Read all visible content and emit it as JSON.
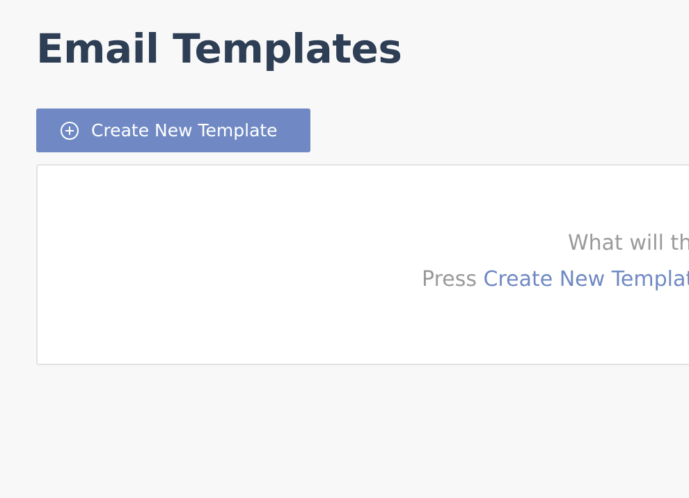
{
  "page": {
    "title": "Email Templates"
  },
  "toolbar": {
    "create_label": "Create New Template",
    "create_icon": "plus-circle-icon"
  },
  "empty_state": {
    "question": "What will th",
    "instruction_prefix": "Press ",
    "instruction_link": "Create New Templat"
  },
  "colors": {
    "accent": "#7089c4",
    "title": "#2e3e55",
    "muted_text": "#9a9a9a",
    "background": "#f8f8f8",
    "panel_border": "#e2e2e2"
  }
}
